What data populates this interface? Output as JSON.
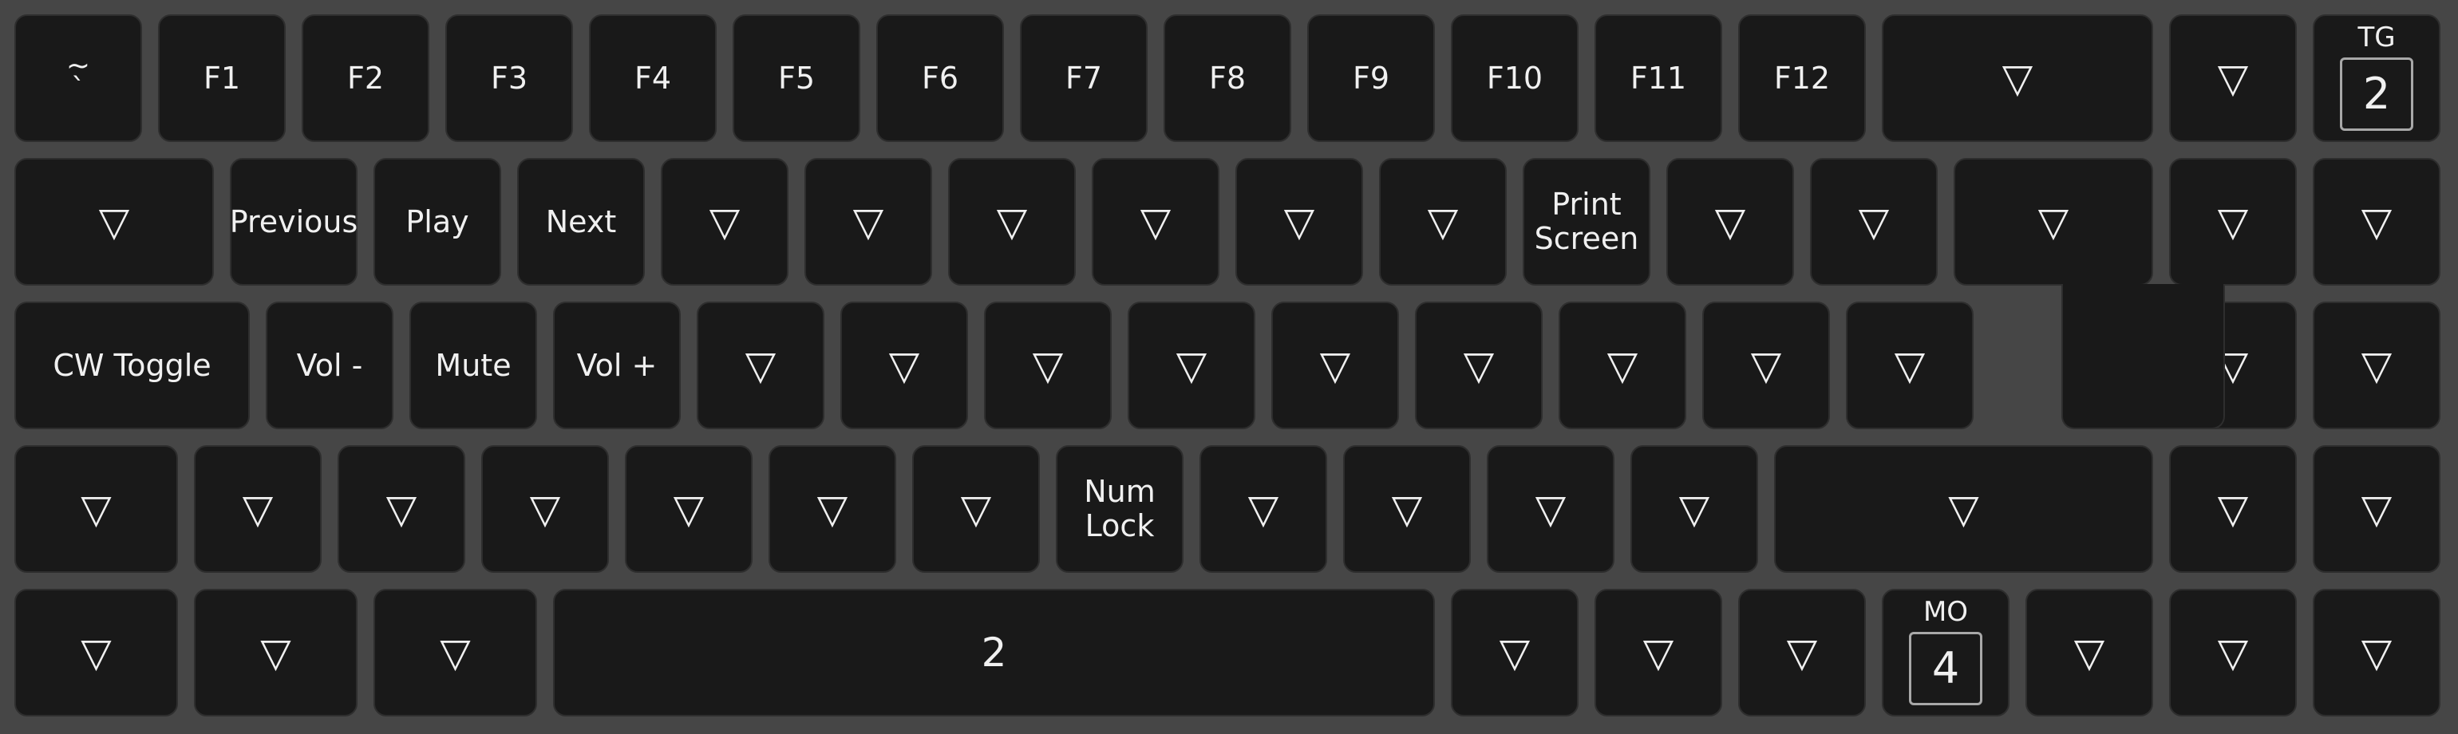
{
  "layer_keys": {
    "tg": {
      "label": "TG",
      "value": "2"
    },
    "mo": {
      "label": "MO",
      "value": "4"
    }
  },
  "rows": [
    {
      "keys": [
        {
          "label": "~\n`"
        },
        {
          "label": "F1"
        },
        {
          "label": "F2"
        },
        {
          "label": "F3"
        },
        {
          "label": "F4"
        },
        {
          "label": "F5"
        },
        {
          "label": "F6"
        },
        {
          "label": "F7"
        },
        {
          "label": "F8"
        },
        {
          "label": "F9"
        },
        {
          "label": "F10"
        },
        {
          "label": "F11"
        },
        {
          "label": "F12"
        },
        {
          "label": "▽"
        },
        {
          "label": "▽"
        },
        {
          "layer": "tg"
        }
      ]
    },
    {
      "keys": [
        {
          "label": "▽"
        },
        {
          "label": "Previous"
        },
        {
          "label": "Play"
        },
        {
          "label": "Next"
        },
        {
          "label": "▽"
        },
        {
          "label": "▽"
        },
        {
          "label": "▽"
        },
        {
          "label": "▽"
        },
        {
          "label": "▽"
        },
        {
          "label": "▽"
        },
        {
          "label": "Print\nScreen"
        },
        {
          "label": "▽"
        },
        {
          "label": "▽"
        },
        {
          "label": "▽"
        },
        {
          "label": "▽"
        },
        {
          "label": "▽"
        }
      ]
    },
    {
      "keys": [
        {
          "label": "CW Toggle"
        },
        {
          "label": "Vol -"
        },
        {
          "label": "Mute"
        },
        {
          "label": "Vol +"
        },
        {
          "label": "▽"
        },
        {
          "label": "▽"
        },
        {
          "label": "▽"
        },
        {
          "label": "▽"
        },
        {
          "label": "▽"
        },
        {
          "label": "▽"
        },
        {
          "label": "▽"
        },
        {
          "label": "▽"
        },
        {
          "label": "▽"
        },
        {
          "label": "▽"
        },
        {
          "label": "▽"
        }
      ]
    },
    {
      "keys": [
        {
          "label": "▽"
        },
        {
          "label": "▽"
        },
        {
          "label": "▽"
        },
        {
          "label": "▽"
        },
        {
          "label": "▽"
        },
        {
          "label": "▽"
        },
        {
          "label": "▽"
        },
        {
          "label": "Num\nLock"
        },
        {
          "label": "▽"
        },
        {
          "label": "▽"
        },
        {
          "label": "▽"
        },
        {
          "label": "▽"
        },
        {
          "label": "▽"
        },
        {
          "label": "▽"
        },
        {
          "label": "▽"
        }
      ]
    },
    {
      "keys": [
        {
          "label": "▽"
        },
        {
          "label": "▽"
        },
        {
          "label": "▽"
        },
        {
          "label": "2"
        },
        {
          "label": "▽"
        },
        {
          "label": "▽"
        },
        {
          "label": "▽"
        },
        {
          "layer": "mo"
        },
        {
          "label": "▽"
        },
        {
          "label": "▽"
        },
        {
          "label": "▽"
        }
      ]
    }
  ]
}
